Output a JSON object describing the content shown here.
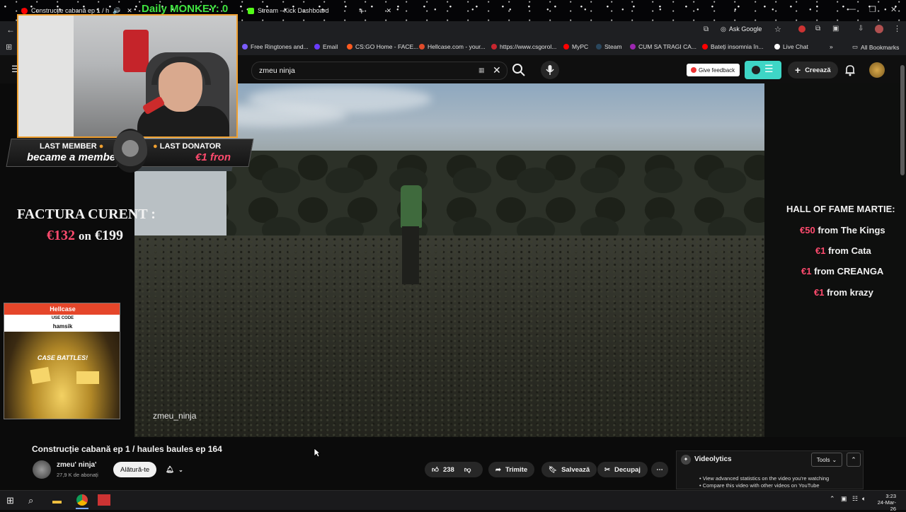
{
  "browser": {
    "tabs": [
      {
        "label": "Construcție cabană ep 1 / h"
      },
      {
        "label": "Daily MONKEY: 0"
      },
      {
        "label": "Stream - Kick Dashboard"
      }
    ],
    "ask_google": "Ask Google",
    "bookmarks": [
      "Free Ringtones and...",
      "Email",
      "CS:GO Home - FACE...",
      "Hellcase.com - your...",
      "https://www.csgorol...",
      "MyPC",
      "Steam",
      "CUM SA TRAGI CA...",
      "Bateți insomnia în...",
      "Live Chat"
    ],
    "all_bookmarks": "All Bookmarks"
  },
  "youtube": {
    "search_value": "zmeu ninja",
    "give_feedback": "Give feedback",
    "create_label": "Creează"
  },
  "overlay": {
    "last_member_title": "LAST MEMBER",
    "last_member_sub": "became a member!",
    "last_donator_title": "LAST DONATOR",
    "last_donator_sub": "€1 fron",
    "factura_title": "FACTURA CURENT :",
    "factura_current": "€132",
    "factura_on": "on",
    "factura_total": "€199",
    "hellcase_brand": "Hellcase",
    "hellcase_use_code": "USE CODE",
    "hellcase_code": "hamsik",
    "hellcase_battles": "CASE BATTLES!",
    "hof_title": "HALL OF FAME MARTIE:",
    "hof": [
      {
        "amount": "€50",
        "text": "from The Kings"
      },
      {
        "amount": "€1",
        "text": "from Cata"
      },
      {
        "amount": "€1",
        "text": "from CREANGA"
      },
      {
        "amount": "€1",
        "text": "from krazy"
      }
    ],
    "accent": "#ff4b6e"
  },
  "video": {
    "watermark": "zmeu_ninja",
    "title": "Construcție cabană ep 1 / haules baules ep 164",
    "channel_name": "zmeu' ninja'",
    "subscribers": "27,9 K de abonați",
    "join_label": "Alătură-te",
    "likes": "238",
    "share_label": "Trimite",
    "save_label": "Salvează",
    "clip_label": "Decupaj"
  },
  "videolytics": {
    "title": "Videolytics",
    "tools_label": "Tools",
    "line1": "View advanced statistics on the video you're watching",
    "line2": "Compare this video with other videos on YouTube"
  },
  "taskbar": {
    "time": "3:23",
    "date": "24-Mar-26"
  }
}
